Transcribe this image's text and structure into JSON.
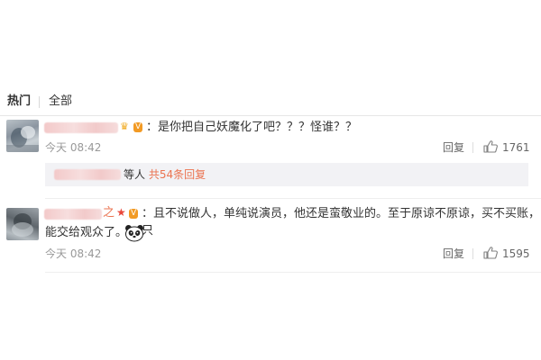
{
  "tabs": {
    "hot": "热门",
    "all": "全部"
  },
  "comments": [
    {
      "text": "：是你把自己妖魔化了吧？？？怪谁？？",
      "time": "今天 08:42",
      "reply": "回复",
      "likes": "1761"
    },
    {
      "text_line1": "：且不说做人，单纯说演员，他还是蛮敬业的。至于原谅不原谅，买不买账，只",
      "text_line2": "能交给观众了。",
      "time": "今天 08:42",
      "reply": "回复",
      "likes": "1595"
    }
  ],
  "subreply": {
    "text": "等人",
    "link": "共54条回复"
  },
  "colors": {
    "accent": "#eb7350",
    "muted": "#999999",
    "subreply_bg": "#f2f2f5"
  },
  "icons": {
    "like": "thumbs-up-icon",
    "panda": "panda-emoji-icon"
  }
}
